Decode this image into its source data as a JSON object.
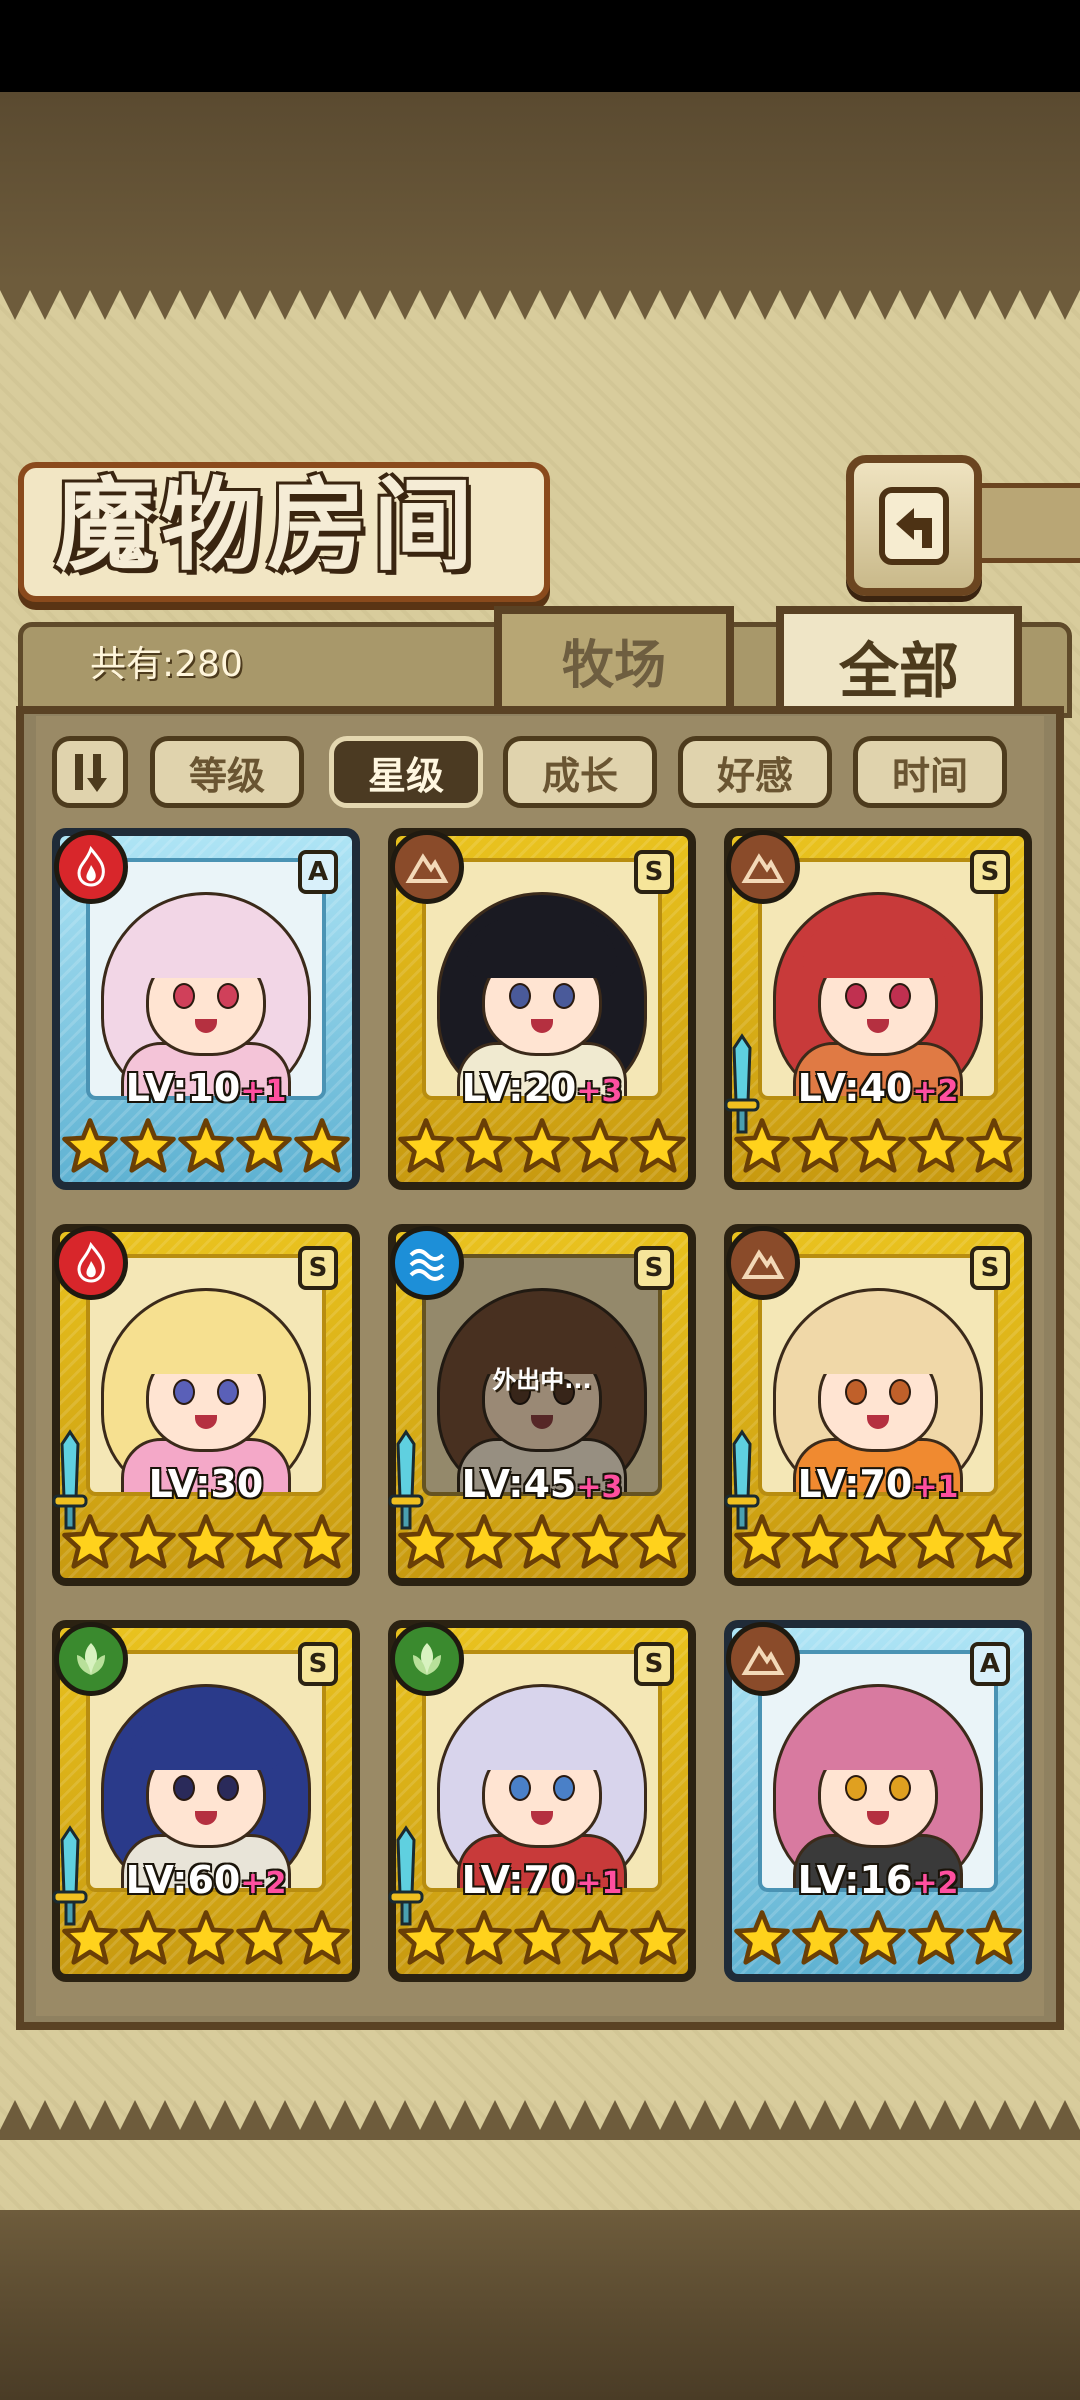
{
  "title": "魔物房间",
  "total_count": "共有:280",
  "tabs": {
    "ranch": "牧场",
    "all": "全部"
  },
  "sort_buttons": [
    "等级",
    "星级",
    "成长",
    "好感",
    "时间"
  ],
  "active_sort": "星级",
  "cards": [
    {
      "element": "fire-icon",
      "rank": "A",
      "frame": "blue",
      "level": "LV:10",
      "plus": "+1",
      "stars": 5,
      "sword": false,
      "hair": "#f2d6e6",
      "eye": "#d0405a",
      "body": "#f4c4d8"
    },
    {
      "element": "earth-icon",
      "rank": "S",
      "frame": "gold",
      "level": "LV:20",
      "plus": "+3",
      "stars": 5,
      "sword": false,
      "hair": "#1a1a22",
      "eye": "#4a5a9a",
      "body": "#f0ead0"
    },
    {
      "element": "earth-icon",
      "rank": "S",
      "frame": "gold",
      "level": "LV:40",
      "plus": "+2",
      "stars": 5,
      "sword": true,
      "hair": "#c83a3a",
      "eye": "#c03050",
      "body": "#e07a44"
    },
    {
      "element": "fire-icon",
      "rank": "S",
      "frame": "gold",
      "level": "LV:30",
      "plus": "",
      "stars": 5,
      "sword": true,
      "hair": "#f6e090",
      "eye": "#5a60b8",
      "body": "#f4a8c8"
    },
    {
      "element": "water-icon",
      "rank": "S",
      "frame": "gold",
      "level": "LV:45",
      "plus": "+3",
      "stars": 5,
      "sword": true,
      "hair": "#8a4a2a",
      "eye": "#6a3a20",
      "body": "#f0f0f0",
      "away": "外出中..."
    },
    {
      "element": "earth-icon",
      "rank": "S",
      "frame": "gold",
      "level": "LV:70",
      "plus": "+1",
      "stars": 5,
      "sword": true,
      "hair": "#f0d8a8",
      "eye": "#c0602a",
      "body": "#f08a30"
    },
    {
      "element": "wind-icon",
      "rank": "S",
      "frame": "gold",
      "level": "LV:60",
      "plus": "+2",
      "stars": 5,
      "sword": true,
      "hair": "#2a3a8a",
      "eye": "#2a2a5a",
      "body": "#e8e4d8"
    },
    {
      "element": "wind-icon",
      "rank": "S",
      "frame": "gold",
      "level": "LV:70",
      "plus": "+1",
      "stars": 5,
      "sword": true,
      "hair": "#d8d4ec",
      "eye": "#4a80c8",
      "body": "#c83a3a"
    },
    {
      "element": "earth-icon",
      "rank": "A",
      "frame": "blue",
      "level": "LV:16",
      "plus": "+2",
      "stars": 5,
      "sword": false,
      "hair": "#d87aa0",
      "eye": "#e0a020",
      "body": "#3a3a3a"
    }
  ]
}
